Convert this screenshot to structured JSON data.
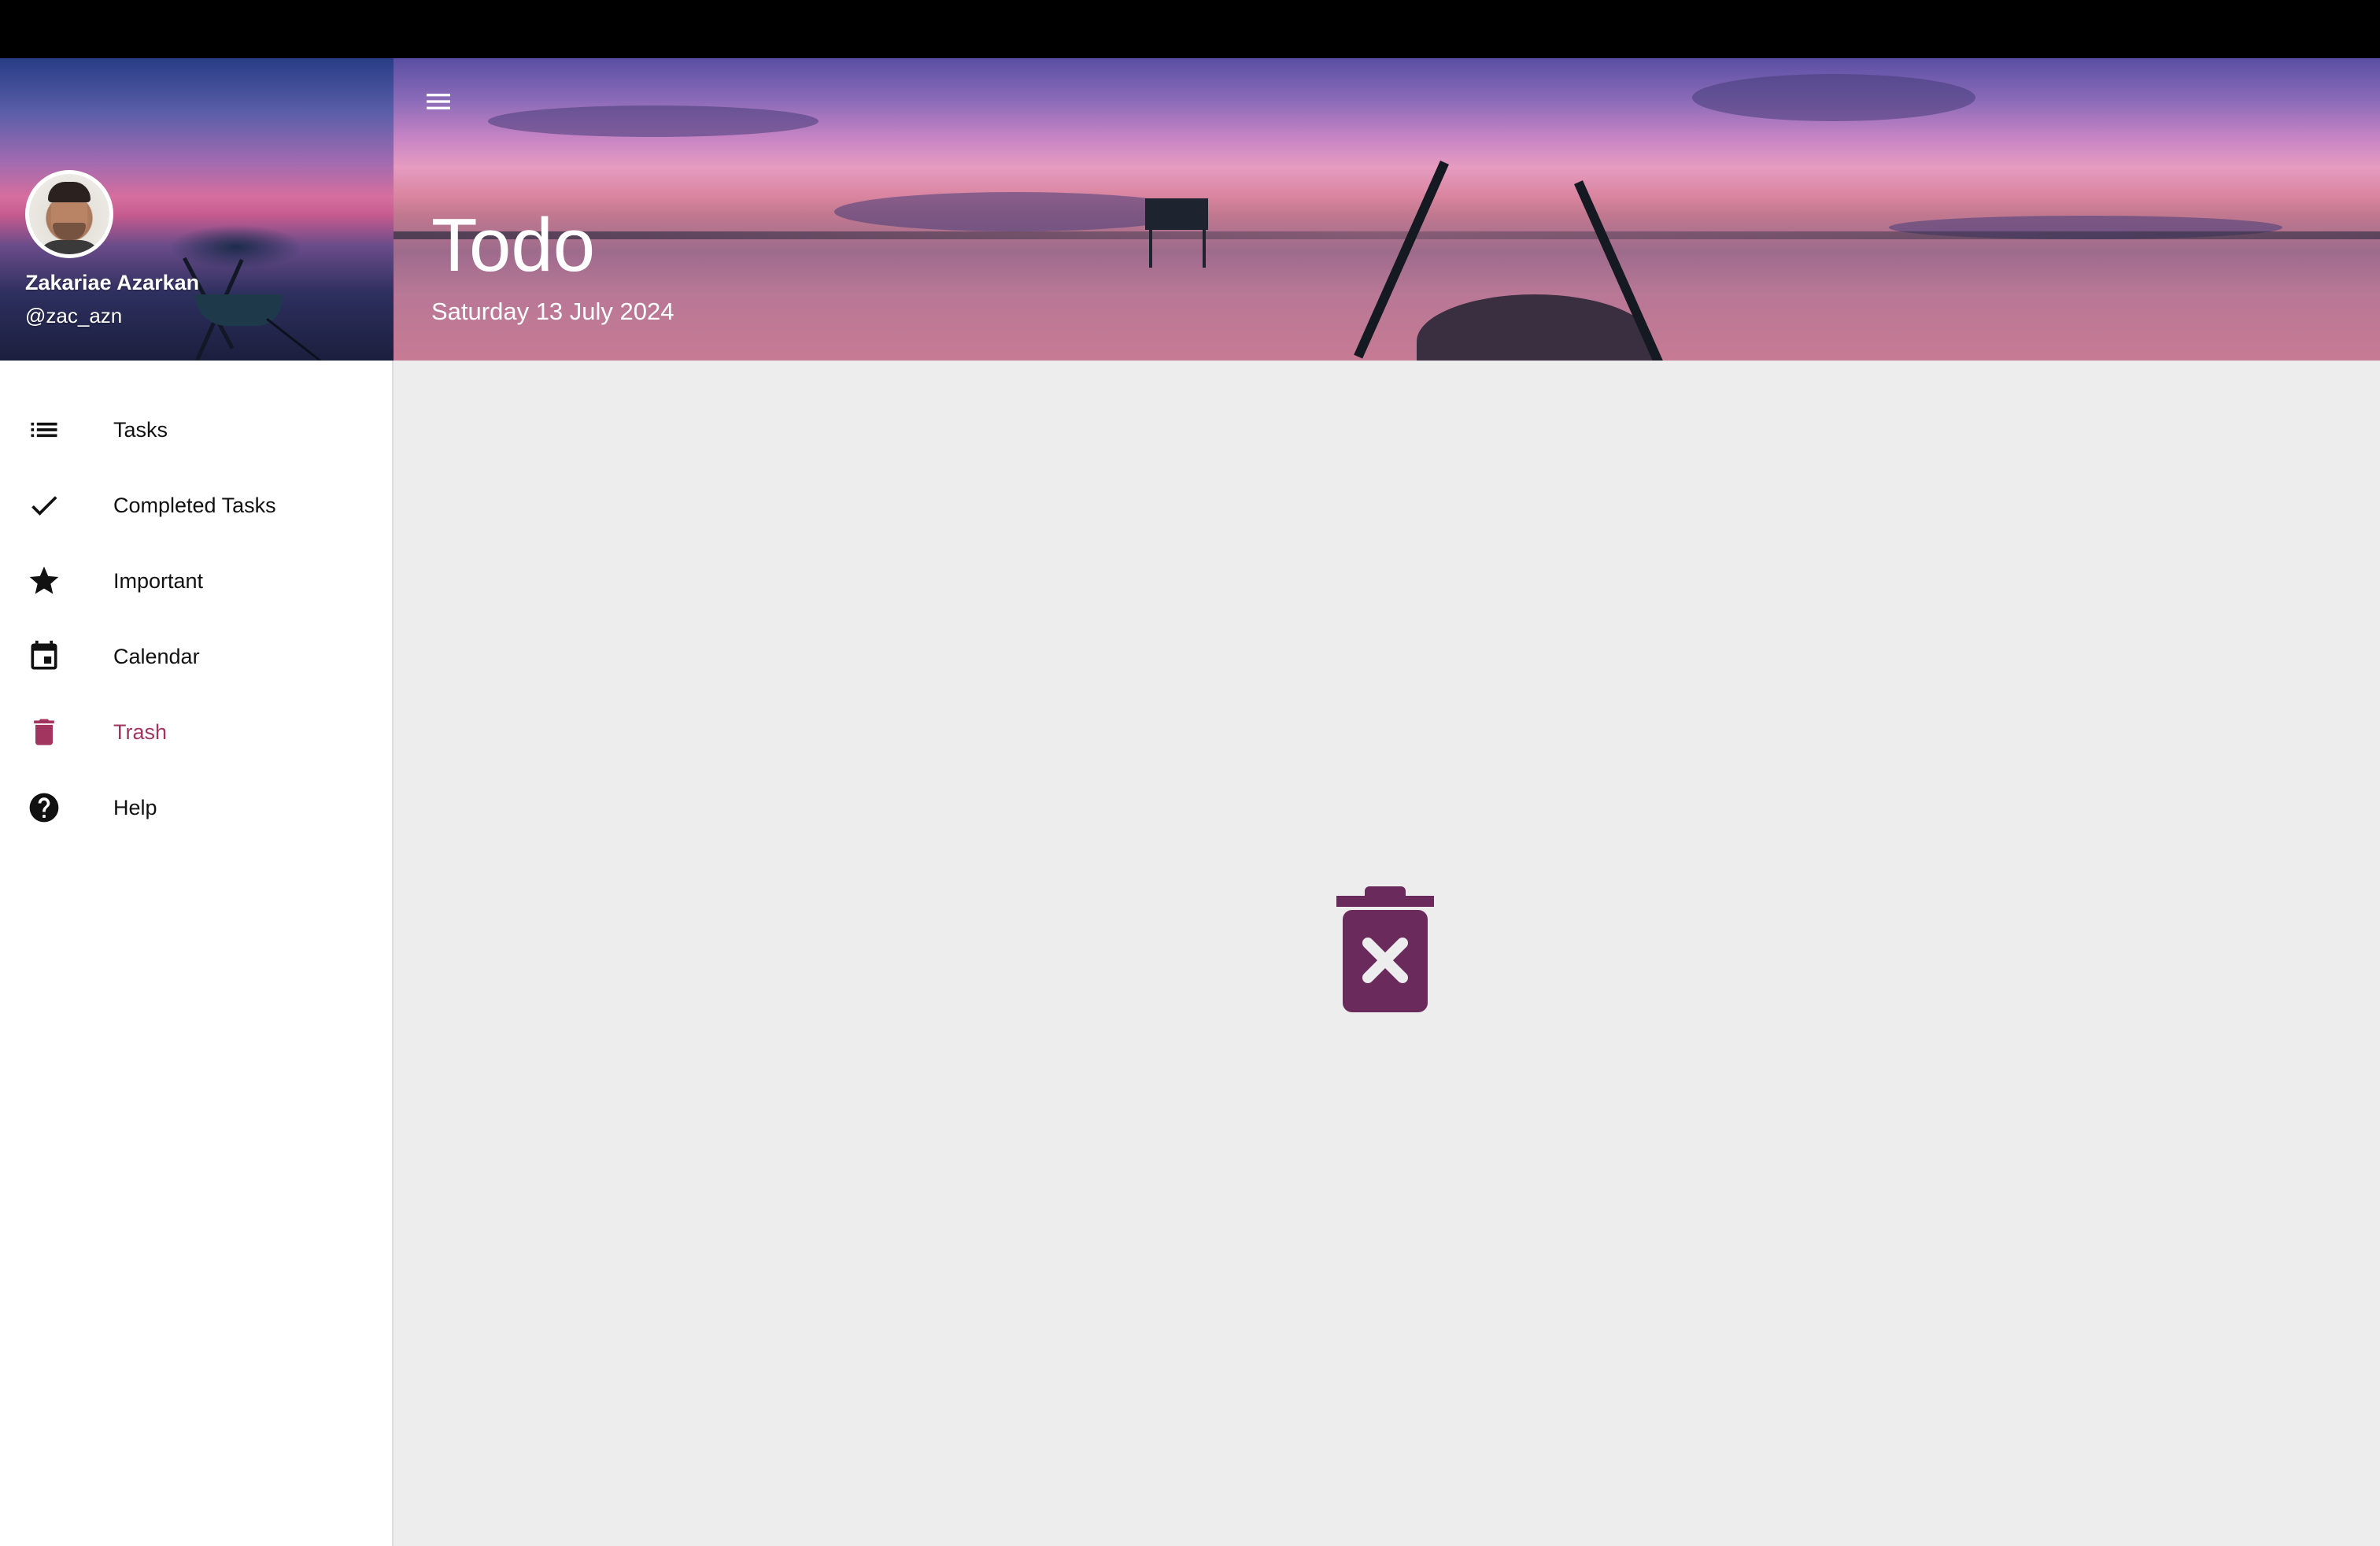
{
  "app": {
    "title": "Todo",
    "date": "Saturday 13 July 2024"
  },
  "user": {
    "name": "Zakariae Azarkan",
    "handle": "@zac_azn"
  },
  "sidebar": {
    "items": [
      {
        "label": "Tasks",
        "icon": "list-icon",
        "active": false
      },
      {
        "label": "Completed Tasks",
        "icon": "check-icon",
        "active": false
      },
      {
        "label": "Important",
        "icon": "star-icon",
        "active": false
      },
      {
        "label": "Calendar",
        "icon": "calendar-icon",
        "active": false
      },
      {
        "label": "Trash",
        "icon": "trash-icon",
        "active": true
      },
      {
        "label": "Help",
        "icon": "help-icon",
        "active": false
      }
    ]
  },
  "header": {
    "menu_icon": "hamburger-menu-icon"
  },
  "content": {
    "empty_state_icon": "trash-empty-icon"
  },
  "colors": {
    "accent": "#a2355f",
    "empty_icon": "#6b2a5c",
    "content_bg": "#ededed",
    "sidebar_bg": "#ffffff"
  }
}
